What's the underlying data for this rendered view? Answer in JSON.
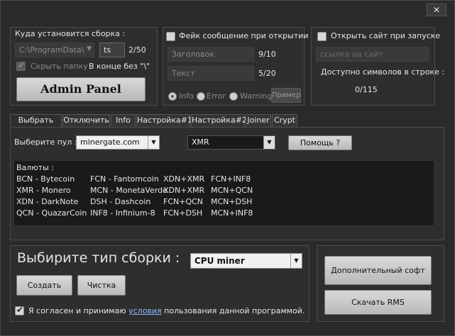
{
  "titlebar": {
    "close": "✕"
  },
  "install": {
    "title": "Куда установится сборка :",
    "path_value": "C:\\ProgramData\\",
    "name_value": "ts",
    "count": "2/50",
    "hide_folder_label": "Скрыть папку",
    "hint": "В конце без \"\\\"",
    "admin_button": "Admin Panel"
  },
  "fake_msg": {
    "title": "Фейк сообщение при открытии",
    "title_placeholder": "Заголовок",
    "title_count": "9/10",
    "text_placeholder": "Текст",
    "text_count": "5/20",
    "radios": [
      "Info",
      "Error",
      "Warning"
    ],
    "example_button": "Пример"
  },
  "open_site": {
    "title": "Открыть сайт при запуске",
    "url_placeholder": "ссылка на сайт",
    "available": "Доступно символов в строке :",
    "count": "0/115"
  },
  "tabs": [
    "Выбрать пул",
    "Отключить",
    "Info",
    "Настройка#1",
    "Настройка#2",
    "Joiner",
    "Crypt"
  ],
  "pool": {
    "label": "Выберите пул :",
    "selected": "minergate.com",
    "coin": "XMR",
    "help_button": "Помощь ?"
  },
  "currencies": {
    "title": "Валюты :",
    "rows": [
      [
        "BCN - Bytecoin",
        "FCN - Fantomcoin",
        "XDN+XMR",
        "FCN+INF8"
      ],
      [
        "XMR - Monero",
        "MCN - MonetaVerde",
        "XDN+XMR",
        "MCN+QCN"
      ],
      [
        "XDN - DarkNote",
        "DSH - Dashcoin",
        "FCN+QCN",
        "MCN+DSH"
      ],
      [
        "QCN - QuazarCoin",
        "INF8 - Infinium-8",
        "FCN+DSH",
        "MCN+INF8"
      ]
    ]
  },
  "build": {
    "title": "Выбирите тип сборки :",
    "type_selected": "CPU miner",
    "create_button": "Создать",
    "clean_button": "Чистка",
    "agree_pre": "Я согласен и принимаю",
    "agree_link": "условия",
    "agree_post": "пользования данной программой."
  },
  "extra": {
    "soft_button": "Дополнительный софт",
    "rms_button": "Скачать RMS"
  }
}
